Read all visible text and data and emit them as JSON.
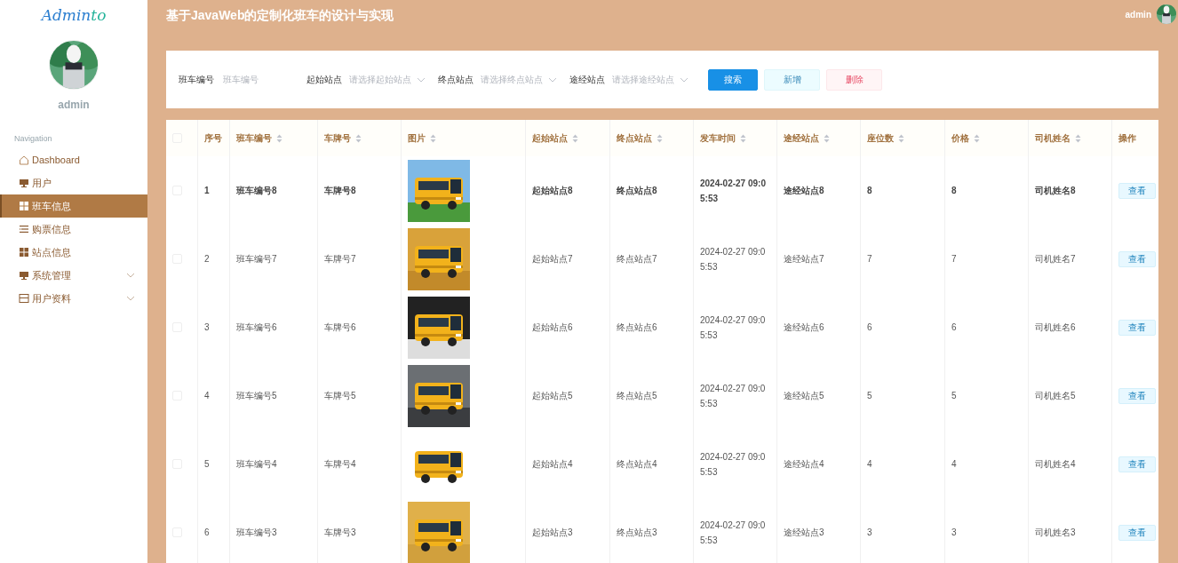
{
  "sidebar": {
    "logo": {
      "main": "Admin",
      "accent": "to"
    },
    "user": "admin",
    "section": "Navigation",
    "items": [
      {
        "label": "Dashboard",
        "kind": "home",
        "selected": false
      },
      {
        "label": "用户",
        "kind": "monitor",
        "selected": false
      },
      {
        "label": "班车信息",
        "kind": "grid",
        "selected": true
      },
      {
        "label": "购票信息",
        "kind": "list",
        "selected": false
      },
      {
        "label": "站点信息",
        "kind": "grid",
        "selected": false
      },
      {
        "label": "系统管理",
        "kind": "monitor",
        "selected": false,
        "expanded": false
      },
      {
        "label": "用户资料",
        "kind": "form",
        "selected": false,
        "expanded": false
      }
    ]
  },
  "header": {
    "title": "基于JavaWeb的定制化班车的设计与实现",
    "user": "admin"
  },
  "search": {
    "fields": [
      {
        "kind": "input",
        "label": "班车编号",
        "placeholder": "班车编号"
      },
      {
        "kind": "select",
        "label": "起始站点",
        "placeholder": "请选择起始站点"
      },
      {
        "kind": "select",
        "label": "终点站点",
        "placeholder": "请选择终点站点"
      },
      {
        "kind": "select",
        "label": "途经站点",
        "placeholder": "请选择途经站点"
      }
    ],
    "buttons": [
      {
        "label": "搜索",
        "kind": "primary"
      },
      {
        "label": "新增",
        "kind": "add"
      },
      {
        "label": "删除",
        "kind": "delete"
      }
    ]
  },
  "table": {
    "columns": [
      {
        "label": "序号",
        "sortable": false
      },
      {
        "label": "班车编号",
        "sortable": true
      },
      {
        "label": "车牌号",
        "sortable": true
      },
      {
        "label": "图片",
        "sortable": true
      },
      {
        "label": "起始站点",
        "sortable": true
      },
      {
        "label": "终点站点",
        "sortable": true
      },
      {
        "label": "发车时间",
        "sortable": true
      },
      {
        "label": "途经站点",
        "sortable": true
      },
      {
        "label": "座位数",
        "sortable": true
      },
      {
        "label": "价格",
        "sortable": true
      },
      {
        "label": "司机姓名",
        "sortable": true
      },
      {
        "label": "操作",
        "sortable": false
      }
    ],
    "all_checked": false,
    "rows": [
      {
        "hovered": true,
        "checked": false,
        "action": "查看",
        "cells": [
          "1",
          "班车编号8",
          "车牌号8",
          null,
          "起始站点8",
          "终点站点8",
          "2024-02-27 09:05:53",
          "途经站点8",
          "8",
          "8",
          "司机姓名8"
        ]
      },
      {
        "hovered": false,
        "checked": false,
        "action": "查看",
        "cells": [
          "2",
          "班车编号7",
          "车牌号7",
          null,
          "起始站点7",
          "终点站点7",
          "2024-02-27 09:05:53",
          "途经站点7",
          "7",
          "7",
          "司机姓名7"
        ]
      },
      {
        "hovered": false,
        "checked": false,
        "action": "查看",
        "cells": [
          "3",
          "班车编号6",
          "车牌号6",
          null,
          "起始站点6",
          "终点站点6",
          "2024-02-27 09:05:53",
          "途经站点6",
          "6",
          "6",
          "司机姓名6"
        ]
      },
      {
        "hovered": false,
        "checked": false,
        "action": "查看",
        "cells": [
          "4",
          "班车编号5",
          "车牌号5",
          null,
          "起始站点5",
          "终点站点5",
          "2024-02-27 09:05:53",
          "途经站点5",
          "5",
          "5",
          "司机姓名5"
        ]
      },
      {
        "hovered": false,
        "checked": false,
        "action": "查看",
        "cells": [
          "5",
          "班车编号4",
          "车牌号4",
          null,
          "起始站点4",
          "终点站点4",
          "2024-02-27 09:05:53",
          "途经站点4",
          "4",
          "4",
          "司机姓名4"
        ]
      },
      {
        "hovered": false,
        "checked": false,
        "action": "查看",
        "cells": [
          "6",
          "班车编号3",
          "车牌号3",
          null,
          "起始站点3",
          "终点站点3",
          "2024-02-27 09:05:53",
          "途经站点3",
          "3",
          "3",
          "司机姓名3"
        ]
      }
    ]
  }
}
